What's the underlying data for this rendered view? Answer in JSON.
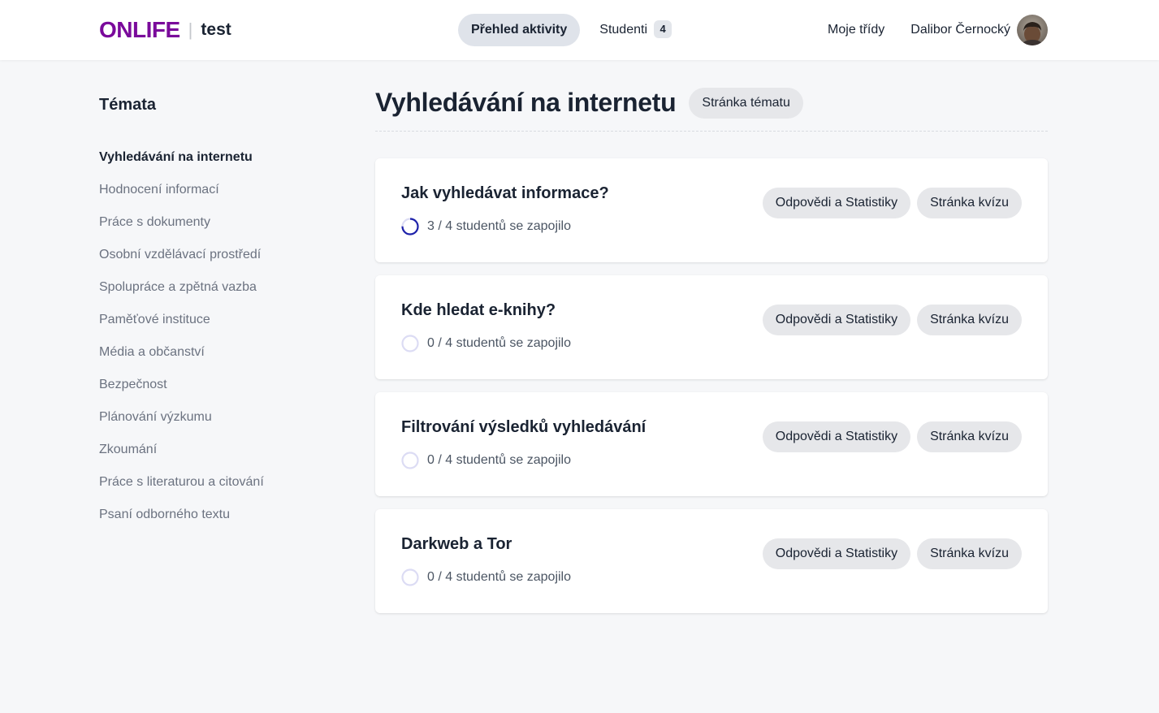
{
  "header": {
    "brand": "ONLIFE",
    "separator": "|",
    "class_name": "test",
    "tabs": [
      {
        "label": "Přehled aktivity",
        "active": true
      },
      {
        "label": "Studenti",
        "count": "4"
      }
    ],
    "my_classes": "Moje třídy",
    "user_name": "Dalibor Černocký"
  },
  "sidebar": {
    "title": "Témata",
    "items": [
      {
        "label": "Vyhledávání na internetu",
        "active": true
      },
      {
        "label": "Hodnocení informací"
      },
      {
        "label": "Práce s dokumenty"
      },
      {
        "label": "Osobní vzdělávací prostředí"
      },
      {
        "label": "Spolupráce a zpětná vazba"
      },
      {
        "label": "Paměťové instituce"
      },
      {
        "label": "Média a občanství"
      },
      {
        "label": "Bezpečnost"
      },
      {
        "label": "Plánování výzkumu"
      },
      {
        "label": "Zkoumání"
      },
      {
        "label": "Práce s literaturou a citování"
      },
      {
        "label": "Psaní odborného textu"
      }
    ]
  },
  "main": {
    "topic_title": "Vyhledávání na internetu",
    "topic_page_button": "Stránka tématu",
    "quizzes": [
      {
        "title": "Jak vyhledávat informace?",
        "progress_text": "3 / 4 studentů se zapojilo",
        "joined": 3,
        "total": 4,
        "stats_button": "Odpovědi a Statistiky",
        "quiz_button": "Stránka kvízu"
      },
      {
        "title": "Kde hledat e-knihy?",
        "progress_text": "0 / 4 studentů se zapojilo",
        "joined": 0,
        "total": 4,
        "stats_button": "Odpovědi a Statistiky",
        "quiz_button": "Stránka kvízu"
      },
      {
        "title": "Filtrování výsledků vyhledávání",
        "progress_text": "0 / 4 studentů se zapojilo",
        "joined": 0,
        "total": 4,
        "stats_button": "Odpovědi a Statistiky",
        "quiz_button": "Stránka kvízu"
      },
      {
        "title": "Darkweb a Tor",
        "progress_text": "0 / 4 studentů se zapojilo",
        "joined": 0,
        "total": 4,
        "stats_button": "Odpovědi a Statistiky",
        "quiz_button": "Stránka kvízu"
      }
    ]
  },
  "colors": {
    "brand": "#7a0a9b",
    "progress_fill": "#1e22aa",
    "progress_track": "#dcdcf4"
  },
  "icons": {
    "avatar": "user-avatar-photo",
    "progress": "progress-ring-icon"
  }
}
